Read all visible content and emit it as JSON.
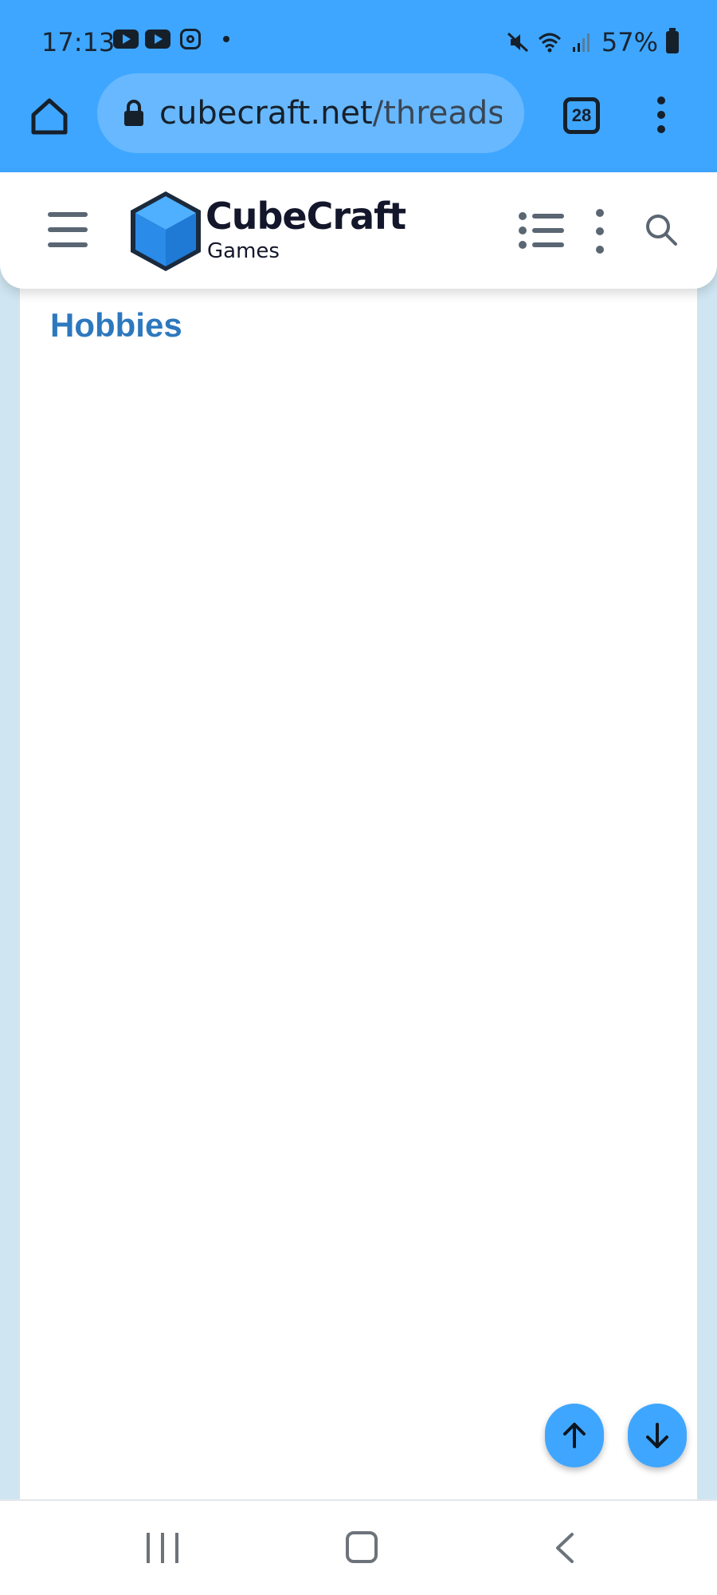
{
  "status_bar": {
    "time": "17:13",
    "battery": "57%"
  },
  "browser": {
    "url_host": "cubecraft.net",
    "url_path": "/threads/yo",
    "tab_count": "28"
  },
  "site": {
    "brand_name": "CubeCraft",
    "brand_sub": "Games"
  },
  "panel": {
    "title": "Hobbies"
  },
  "colors": {
    "accent": "#3ea6ff",
    "title_blue": "#2d78be",
    "logo_blue": "#2a8be8"
  }
}
